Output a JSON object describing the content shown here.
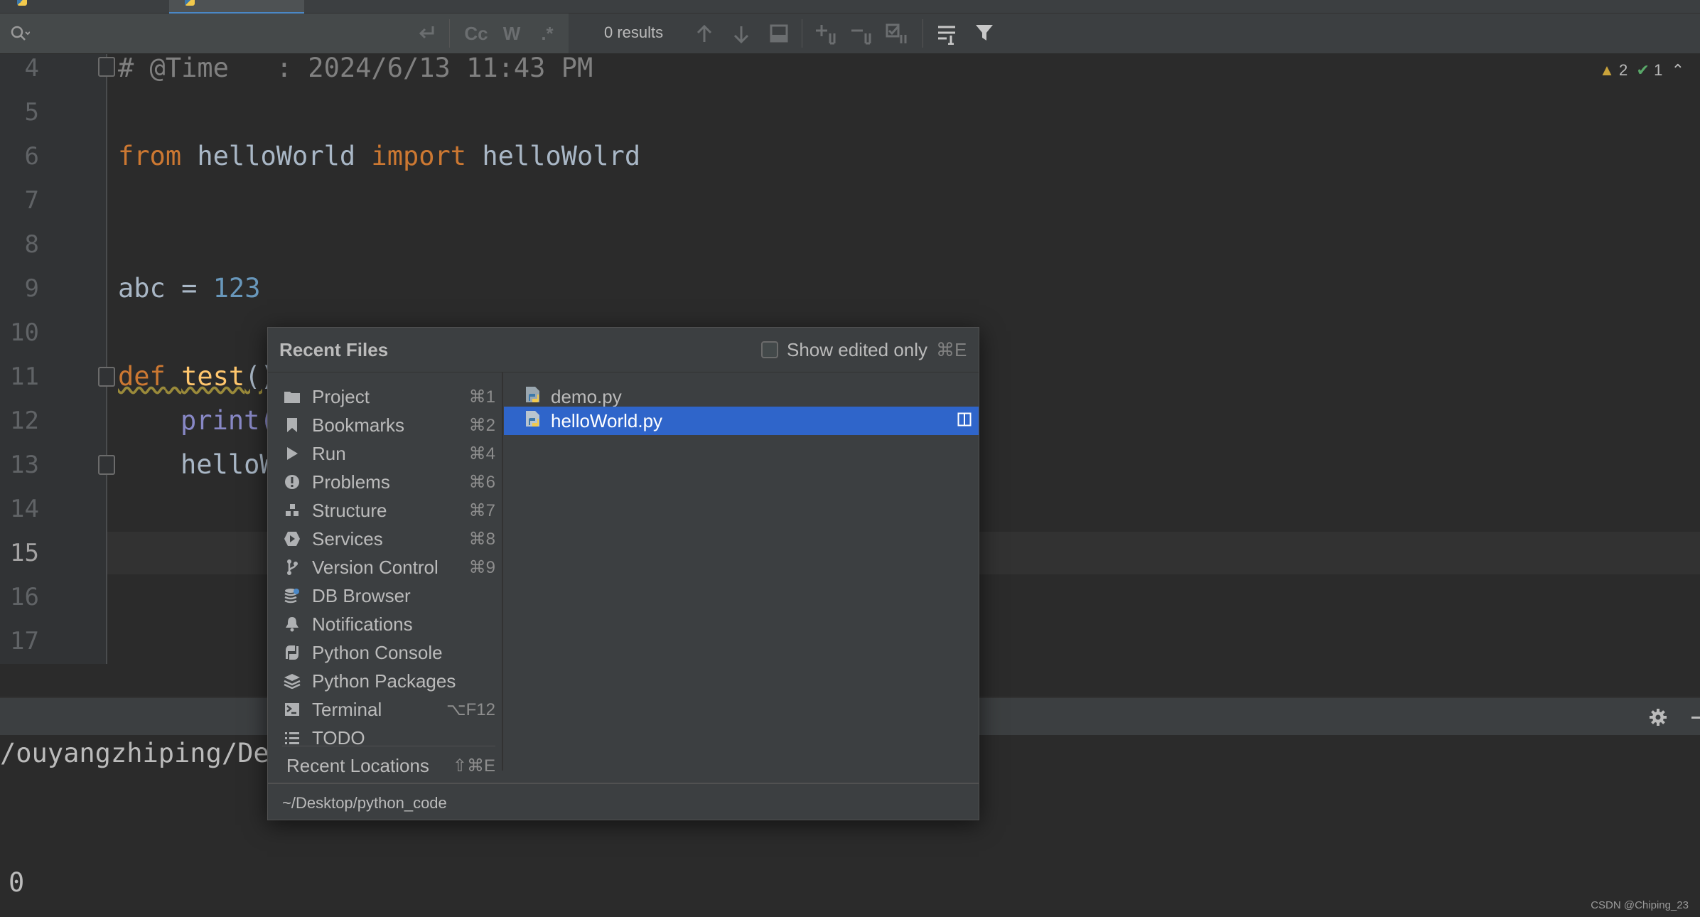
{
  "find_bar": {
    "placeholder": "",
    "toggle_case": "Cc",
    "toggle_words": "W",
    "toggle_regex": ".*",
    "results": "0 results"
  },
  "editor": {
    "lines": [
      4,
      5,
      6,
      7,
      8,
      9,
      10,
      11,
      12,
      13,
      14,
      15,
      16,
      17
    ],
    "current_line": 15,
    "code": {
      "l4_comment": "# @Time   : 2024/6/13 11:43 PM",
      "l6_from": "from",
      "l6_module": " helloWorld ",
      "l6_import": "import",
      "l6_name": " helloWolrd",
      "l9_var": "abc = ",
      "l9_num": "123",
      "l11_def": "def",
      "l11_space": " ",
      "l11_fn": "test",
      "l11_paren": "()",
      "l12_print": "print(",
      "l13_call": "helloW"
    },
    "inspection": {
      "warnings": "2",
      "ok": "1"
    }
  },
  "console": {
    "path_line": "/ouyangzhiping/Des",
    "output_line": "0"
  },
  "watermark": "CSDN @Chiping_23",
  "popup": {
    "title": "Recent Files",
    "show_edited_label": "Show edited only",
    "show_edited_shortcut": "⌘E",
    "tool_windows": [
      {
        "label": "Project",
        "shortcut": "⌘1",
        "icon": "folder-icon"
      },
      {
        "label": "Bookmarks",
        "shortcut": "⌘2",
        "icon": "bookmark-icon"
      },
      {
        "label": "Run",
        "shortcut": "⌘4",
        "icon": "run-icon"
      },
      {
        "label": "Problems",
        "shortcut": "⌘6",
        "icon": "problems-icon"
      },
      {
        "label": "Structure",
        "shortcut": "⌘7",
        "icon": "structure-icon"
      },
      {
        "label": "Services",
        "shortcut": "⌘8",
        "icon": "services-icon"
      },
      {
        "label": "Version Control",
        "shortcut": "⌘9",
        "icon": "vcs-icon"
      },
      {
        "label": "DB Browser",
        "shortcut": "",
        "icon": "db-icon"
      },
      {
        "label": "Notifications",
        "shortcut": "",
        "icon": "bell-icon"
      },
      {
        "label": "Python Console",
        "shortcut": "",
        "icon": "python-console-icon"
      },
      {
        "label": "Python Packages",
        "shortcut": "",
        "icon": "packages-icon"
      },
      {
        "label": "Terminal",
        "shortcut": "⌥F12",
        "icon": "terminal-icon"
      },
      {
        "label": "TODO",
        "shortcut": "",
        "icon": "todo-icon"
      }
    ],
    "recent_locations": {
      "label": "Recent Locations",
      "shortcut": "⇧⌘E"
    },
    "files": [
      {
        "name": "demo.py"
      },
      {
        "name": "helloWorld.py",
        "selected": true
      }
    ],
    "path": "~/Desktop/python_code"
  },
  "colors": {
    "selection": "#2f65ca",
    "keyword": "#cc7832",
    "function": "#ffc66d",
    "number": "#6897bb"
  }
}
